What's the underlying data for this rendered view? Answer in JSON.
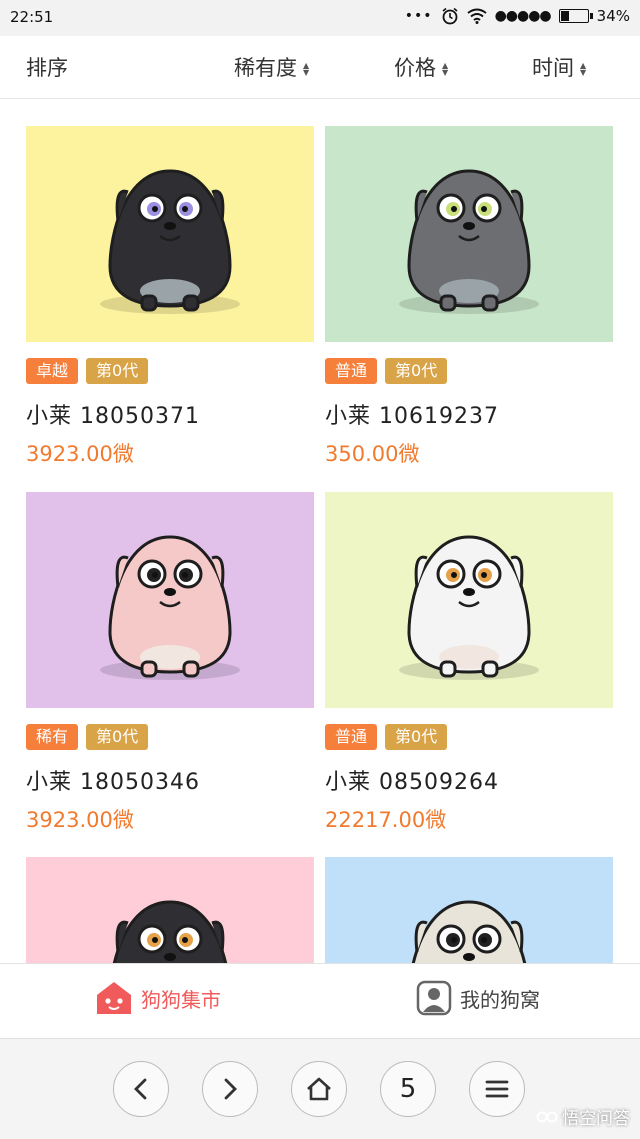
{
  "status": {
    "time": "22:51",
    "battery": "34%",
    "battery_level": 0.34
  },
  "sortbar": {
    "label": "排序",
    "options": [
      {
        "label": "稀有度"
      },
      {
        "label": "价格"
      },
      {
        "label": "时间"
      }
    ]
  },
  "dogs": [
    {
      "name": "小莱",
      "id": "18050371",
      "rarity": "卓越",
      "generation": "第0代",
      "price": "3923.00微",
      "bg": "#fdf39e",
      "body": "#2f2f33"
    },
    {
      "name": "小莱",
      "id": "10619237",
      "rarity": "普通",
      "generation": "第0代",
      "price": "350.00微",
      "bg": "#c8e6c9",
      "body": "#6d6e72"
    },
    {
      "name": "小莱",
      "id": "18050346",
      "rarity": "稀有",
      "generation": "第0代",
      "price": "3923.00微",
      "bg": "#e1c0ea",
      "body": "#f6c9c9"
    },
    {
      "name": "小莱",
      "id": "08509264",
      "rarity": "普通",
      "generation": "第0代",
      "price": "22217.00微",
      "bg": "#eff6c6",
      "body": "#f4f4f4"
    },
    {
      "bg": "#ffcdd8",
      "body": "#2f2f33"
    },
    {
      "bg": "#bfe0f8",
      "body": "#e9e4da"
    }
  ],
  "tabs": {
    "market": "狗狗集市",
    "mine": "我的狗窝"
  },
  "browser": {
    "tabs_count": "5"
  },
  "watermark": "悟空问答",
  "colors": {
    "accent": "#f05a5a",
    "price": "#f07a2e",
    "rarity_tag": "#f57f3b",
    "generation_tag": "#d9a448"
  }
}
